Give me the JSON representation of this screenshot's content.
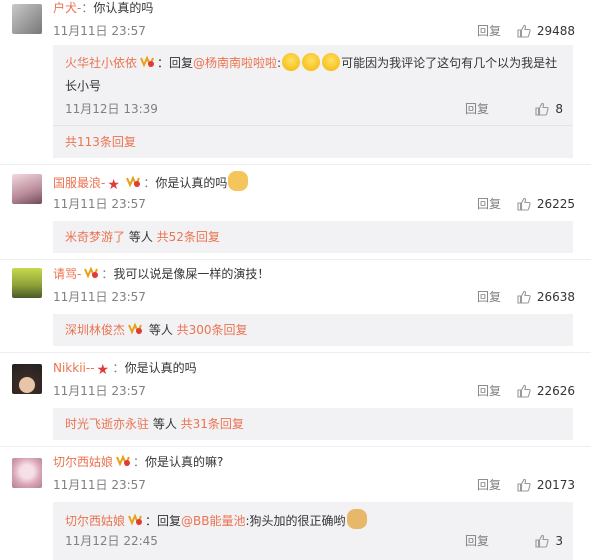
{
  "comments": [
    {
      "user": "户犬-",
      "sep": "：",
      "text": "你认真的吗",
      "time": "11月11日 23:57",
      "reply_label": "回复",
      "likes": "29488",
      "sub": {
        "user": "火华社小依依",
        "text_a": "：回复",
        "mention": "@杨南南啦啦啦",
        "text_b": ":",
        "text_c": "可能因为我评论了这句有几个以为我是社",
        "text_d": "长小号",
        "time": "11月12日 13:39",
        "reply_label": "回复",
        "likes": "8"
      },
      "more": "共113条回复"
    },
    {
      "user": "国服最浪-",
      "sep": "：",
      "text": "你是认真的吗",
      "time": "11月11日 23:57",
      "reply_label": "回复",
      "likes": "26225",
      "box": {
        "user": "米奇梦游了",
        "mid": " 等人 ",
        "more": "共52条回复"
      }
    },
    {
      "user": "请骂-",
      "sep": "：",
      "text": "我可以说是像屎一样的演技！",
      "time": "11月11日 23:57",
      "reply_label": "回复",
      "likes": "26638",
      "box": {
        "user": "深圳林俊杰",
        "mid": " 等人 ",
        "more": "共300条回复"
      }
    },
    {
      "user": "Nikkii--",
      "sep": "：",
      "text": "你是认真的吗",
      "time": "11月11日 23:57",
      "reply_label": "回复",
      "likes": "22626",
      "box": {
        "user": "时光飞逝亦永驻",
        "mid": " 等人 ",
        "more": "共31条回复"
      }
    },
    {
      "user": "切尔西姑娘",
      "sep": "：",
      "text": "你是认真的嘛?",
      "time": "11月11日 23:57",
      "reply_label": "回复",
      "likes": "20173",
      "sub": {
        "user": "切尔西姑娘",
        "text_a": "：回复",
        "mention": "@BB能量池",
        "text_b": ":狗头加的很正确哟",
        "time": "11月12日 22:45",
        "reply_label": "回复",
        "likes": "3"
      }
    }
  ],
  "colors": {
    "accent": "#eb7350",
    "grey": "#808080",
    "box": "#f2f2f5"
  },
  "icons": [
    "thumb-up-icon",
    "vip-badge-icon",
    "red-star-icon",
    "laugh-cry-emoji",
    "doge-emoji"
  ]
}
